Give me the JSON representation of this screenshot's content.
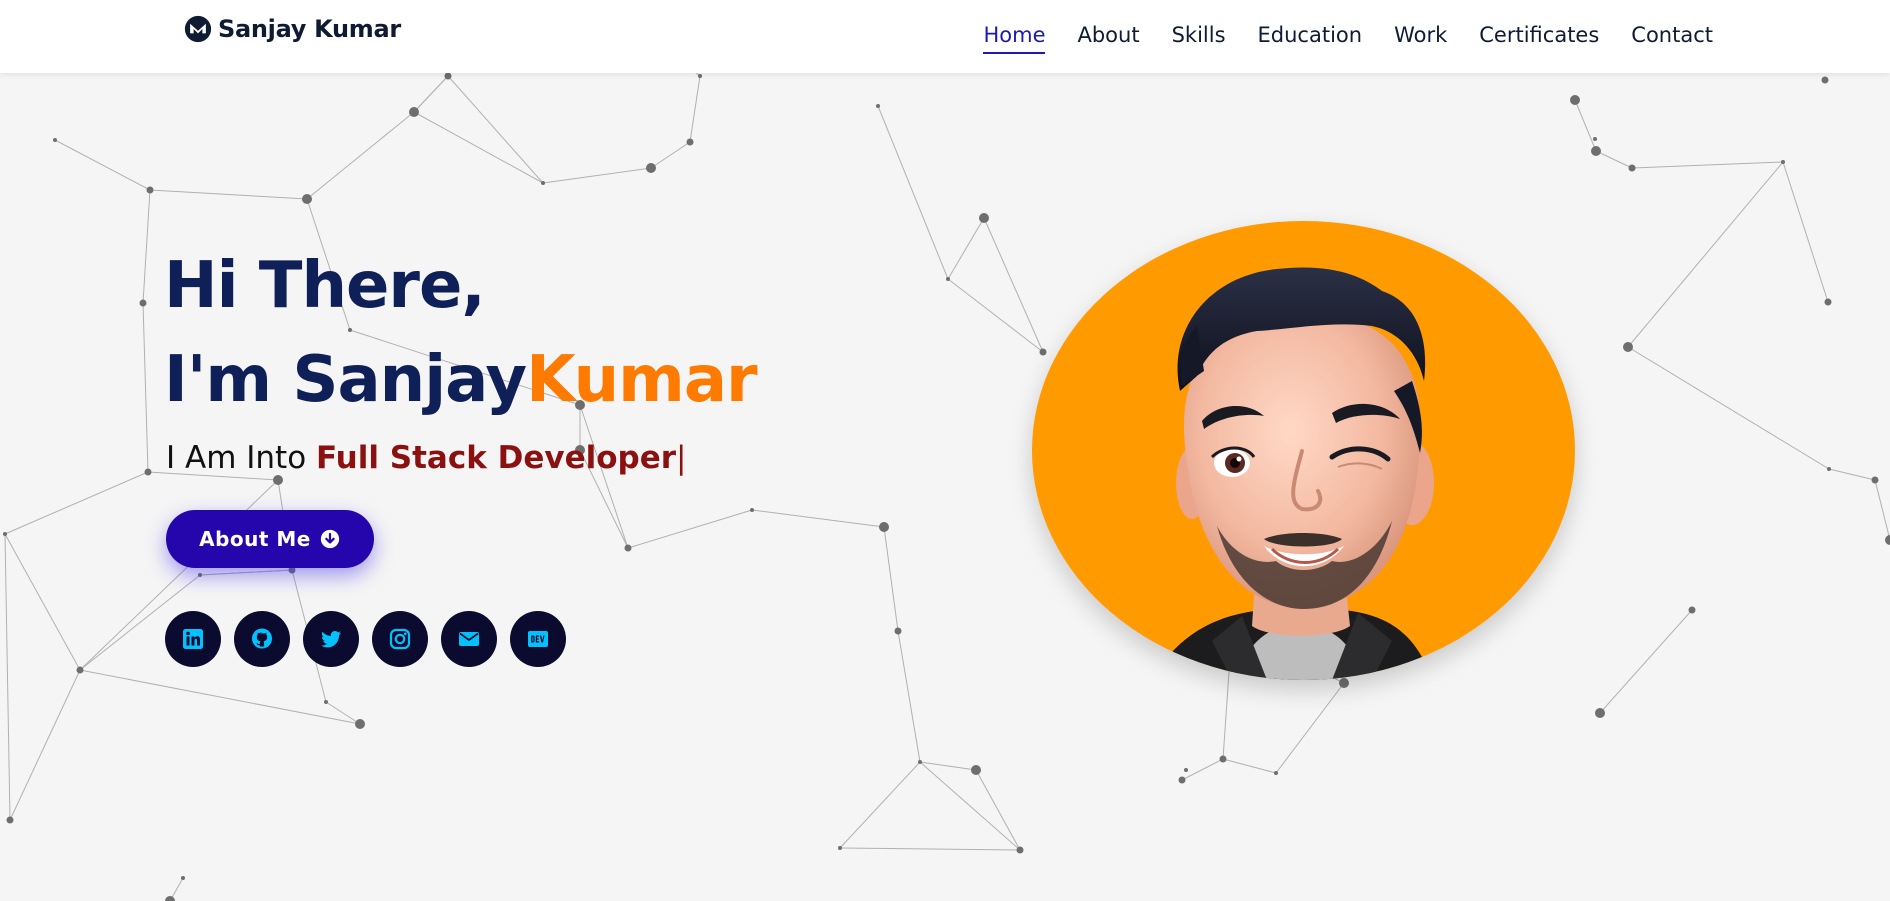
{
  "brand": {
    "name": "Sanjay Kumar",
    "icon": "monero-logo-icon"
  },
  "nav": {
    "items": [
      {
        "label": "Home",
        "active": true
      },
      {
        "label": "About",
        "active": false
      },
      {
        "label": "Skills",
        "active": false
      },
      {
        "label": "Education",
        "active": false
      },
      {
        "label": "Work",
        "active": false
      },
      {
        "label": "Certificates",
        "active": false
      },
      {
        "label": "Contact",
        "active": false
      }
    ]
  },
  "hero": {
    "greeting": "Hi There,",
    "intro_prefix": "I'm ",
    "first_name": "Sanjay",
    "last_name": "Kumar",
    "subtitle_prefix": "I Am Into ",
    "typed_text": "Full Stack Developer",
    "cursor": "|",
    "button_label": "About Me",
    "button_icon": "arrow-down-circle-icon"
  },
  "socials": [
    {
      "name": "LinkedIn",
      "icon": "linkedin-icon"
    },
    {
      "name": "GitHub",
      "icon": "github-icon"
    },
    {
      "name": "Twitter",
      "icon": "twitter-icon"
    },
    {
      "name": "Instagram",
      "icon": "instagram-icon"
    },
    {
      "name": "Email",
      "icon": "envelope-icon"
    },
    {
      "name": "DEV",
      "icon": "dev-icon"
    }
  ],
  "avatar": {
    "icon": "avatar-illustration"
  },
  "colors": {
    "background": "#f5f5f5",
    "heading": "#0e2057",
    "accent_orange": "#ff7a00",
    "typed_red": "#8b1010",
    "nav_active": "#1b1bb0",
    "button": "#2506ad",
    "social_bg": "#0a0b2e",
    "social_icon": "#00c2ff",
    "avatar_bg": "#ff9a00"
  }
}
